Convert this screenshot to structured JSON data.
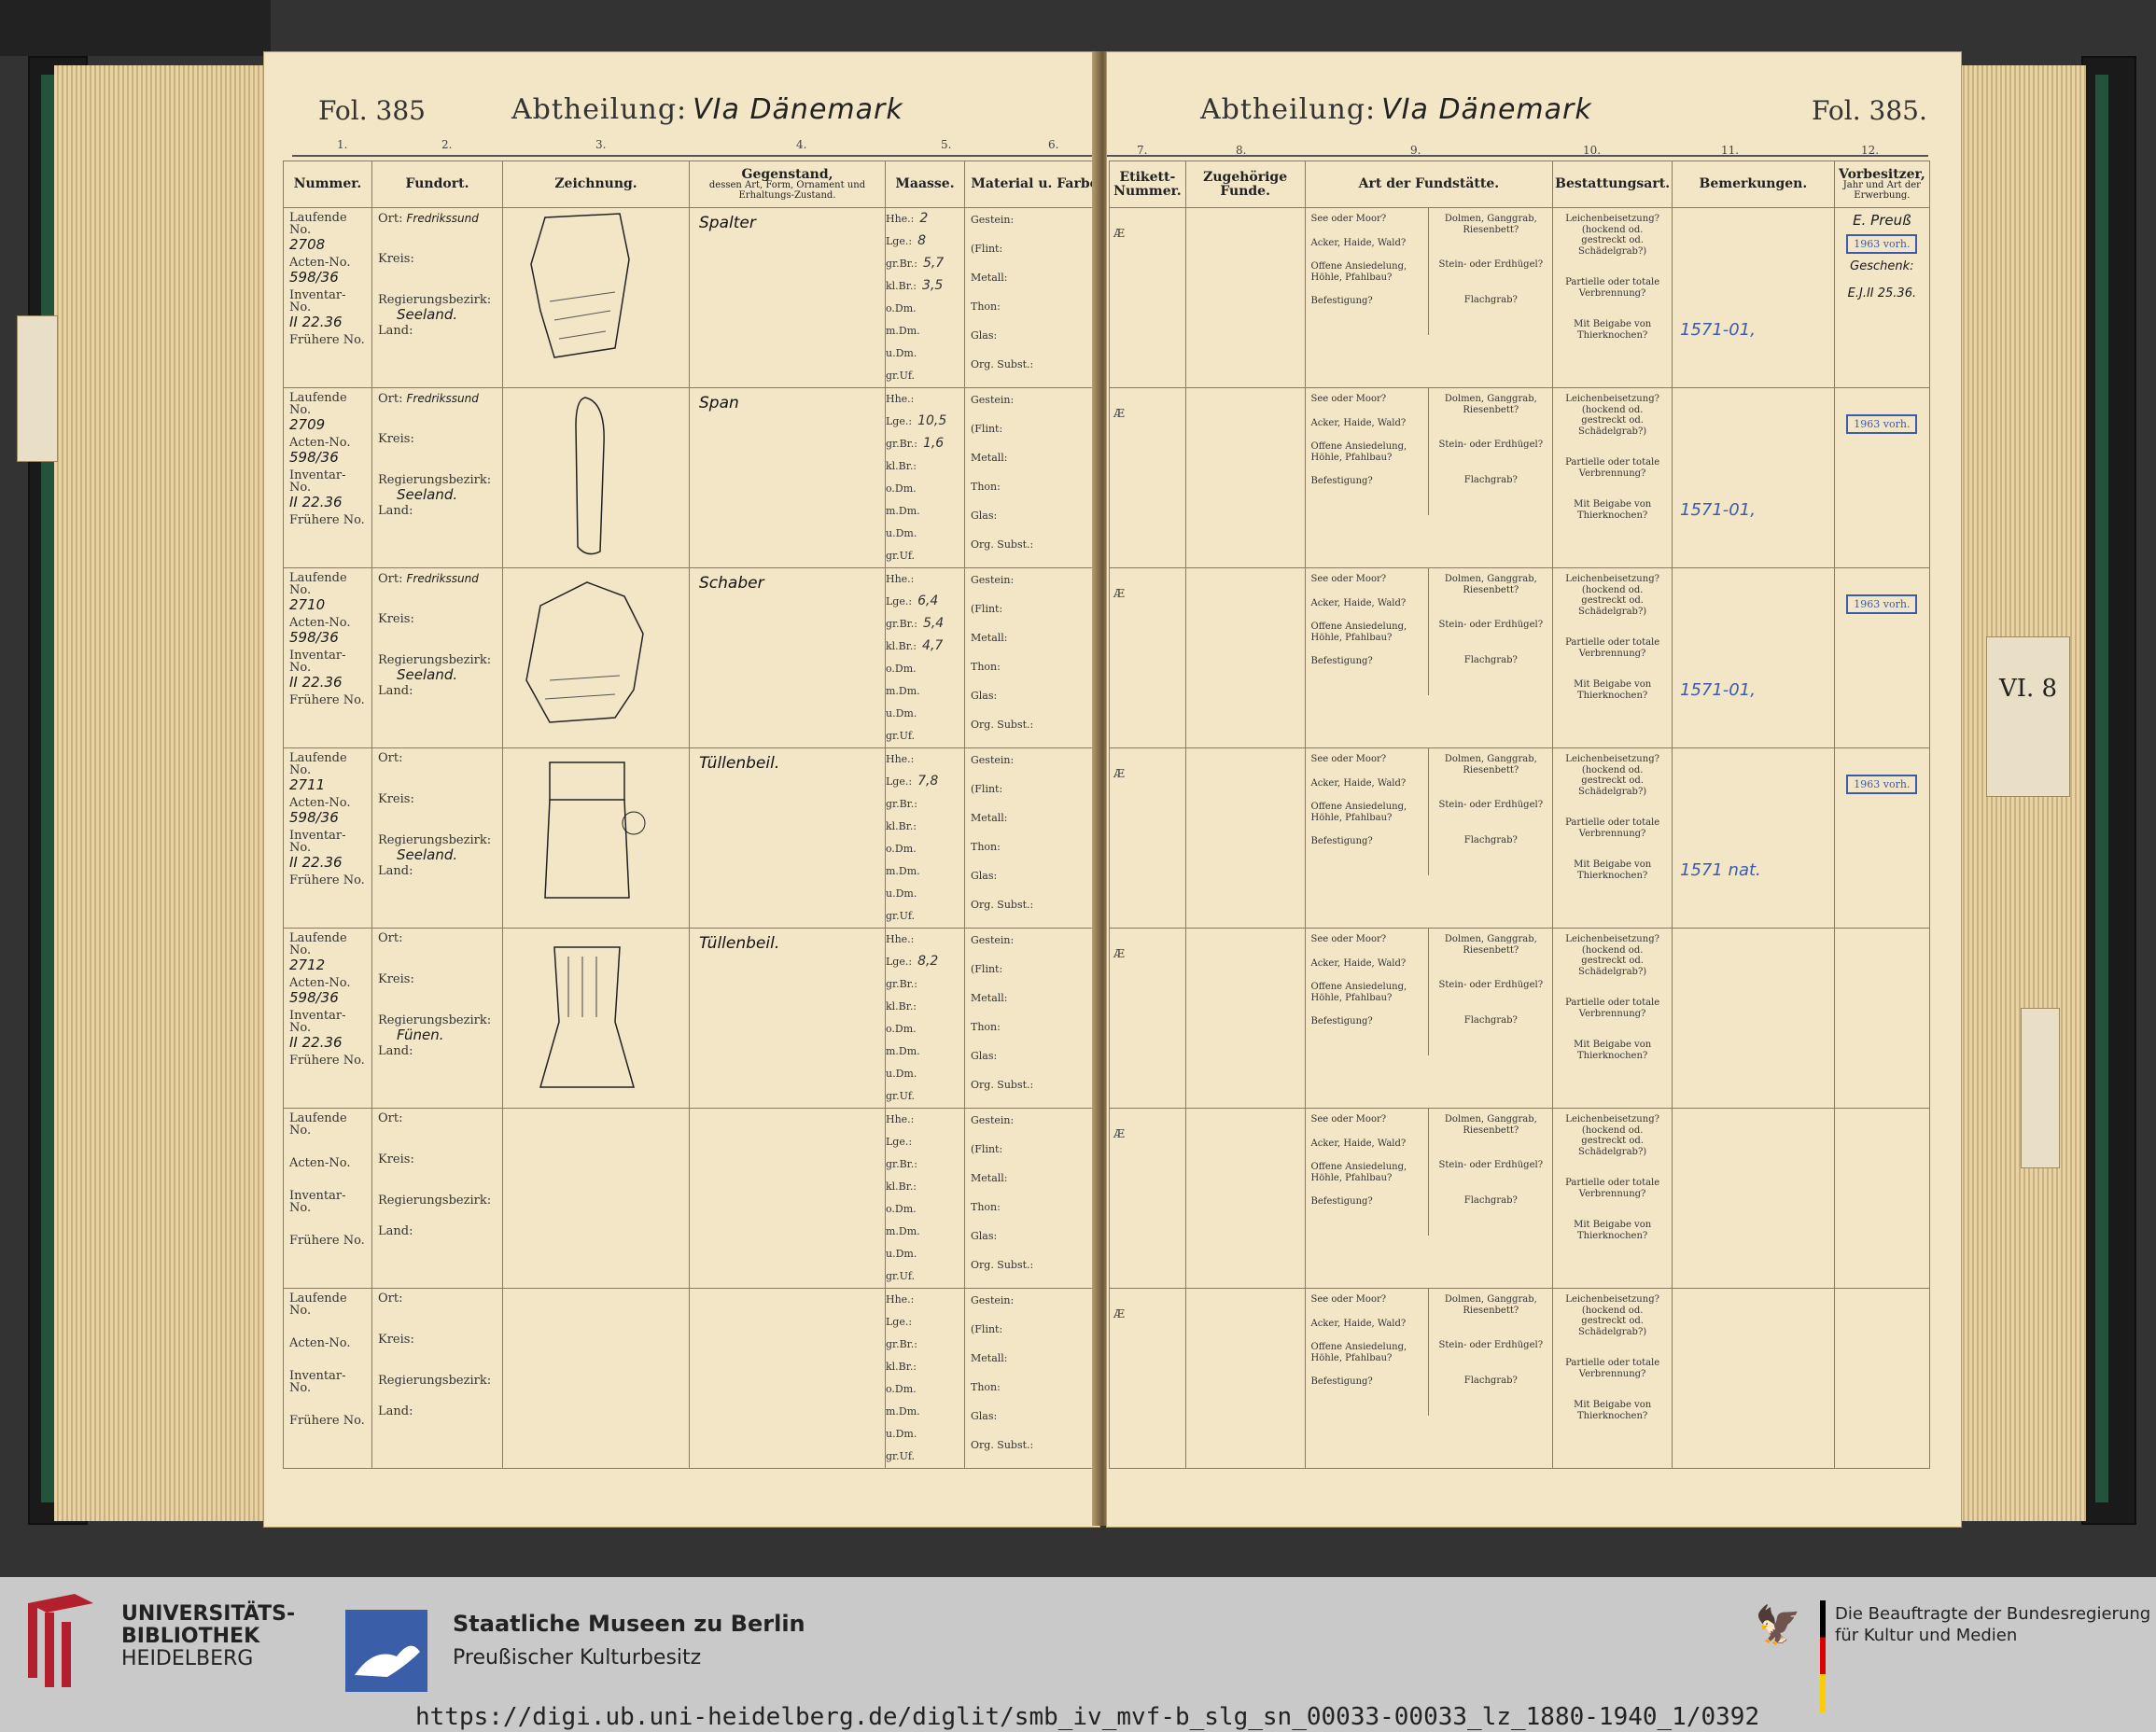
{
  "left_page": {
    "folio_label": "Fol. 385",
    "abtheilung_label": "Abtheilung:",
    "abtheilung_value": "VIa Dänemark",
    "column_numbers": [
      "1.",
      "2.",
      "3.",
      "4.",
      "5.",
      "6."
    ],
    "headers": {
      "nummer": "Nummer.",
      "fundort": "Fundort.",
      "zeichnung": "Zeichnung.",
      "gegenstand": "Gegenstand,",
      "gegenstand_sub": "dessen Art, Form, Ornament und Erhaltungs-Zustand.",
      "maasse": "Maasse.",
      "material": "Material u. Farbe"
    },
    "row_labels": {
      "laufende": "Laufende No.",
      "acten": "Acten-No.",
      "inventar": "Inventar-No.",
      "fruehere": "Frühere No.",
      "ort": "Ort:",
      "kreis": "Kreis:",
      "regbez": "Regierungsbezirk:",
      "land": "Land:"
    },
    "measure_labels": [
      "Hhe.:",
      "Lge.:",
      "gr.Br.:",
      "kl.Br.:",
      "o.Dm.",
      "m.Dm.",
      "u.Dm.",
      "gr.Uf."
    ],
    "material_labels": [
      "Gestein:",
      "(Flint:",
      "Metall:",
      "Thon:",
      "Glas:",
      "Org. Subst.:"
    ],
    "rows": [
      {
        "laufende": "2708",
        "acten": "598/36",
        "inventar": "II 22.36",
        "ort": "Fredrikssund",
        "regbez": "Seeland.",
        "object": "Spalter",
        "measures": [
          "2",
          "8",
          "5,7",
          "3,5",
          "",
          "",
          "",
          ""
        ]
      },
      {
        "laufende": "2709",
        "acten": "598/36",
        "inventar": "II 22.36",
        "ort": "Fredrikssund",
        "regbez": "Seeland.",
        "object": "Span",
        "measures": [
          "",
          "10,5",
          "1,6",
          "",
          "",
          "",
          "",
          ""
        ]
      },
      {
        "laufende": "2710",
        "acten": "598/36",
        "inventar": "II 22.36",
        "ort": "Fredrikssund",
        "regbez": "Seeland.",
        "object": "Schaber",
        "measures": [
          "",
          "6,4",
          "5,4",
          "4,7",
          "",
          "",
          "",
          ""
        ]
      },
      {
        "laufende": "2711",
        "acten": "598/36",
        "inventar": "II 22.36",
        "ort": "",
        "regbez": "Seeland.",
        "object": "Tüllenbeil.",
        "measures": [
          "",
          "7,8",
          "",
          "",
          "",
          "",
          "",
          ""
        ]
      },
      {
        "laufende": "2712",
        "acten": "598/36",
        "inventar": "II 22.36",
        "ort": "",
        "regbez": "Fünen.",
        "object": "Tüllenbeil.",
        "measures": [
          "",
          "8,2",
          "",
          "",
          "",
          "",
          "",
          ""
        ]
      },
      {
        "laufende": "",
        "acten": "",
        "inventar": "",
        "ort": "",
        "regbez": "",
        "object": "",
        "measures": [
          "",
          "",
          "",
          "",
          "",
          "",
          "",
          ""
        ]
      },
      {
        "laufende": "",
        "acten": "",
        "inventar": "",
        "ort": "",
        "regbez": "",
        "object": "",
        "measures": [
          "",
          "",
          "",
          "",
          "",
          "",
          "",
          ""
        ]
      }
    ]
  },
  "right_page": {
    "folio_label": "Fol. 385.",
    "abtheilung_label": "Abtheilung:",
    "abtheilung_value": "VIa Dänemark",
    "column_numbers": [
      "7.",
      "8.",
      "9.",
      "10.",
      "11.",
      "12."
    ],
    "headers": {
      "etikett": "Etikett-Nummer.",
      "zugehoerige": "Zugehörige Funde.",
      "fundstaette": "Art der Fundstätte.",
      "bestattung": "Bestattungsart.",
      "bemerkungen": "Bemerkungen.",
      "vorbesitzer": "Vorbesitzer,",
      "vorbesitzer_sub": "Jahr und Art der Erwerbung."
    },
    "etikett_mark": "Æ",
    "fundstaette_q": [
      "See oder Moor?",
      "Acker, Haide, Wald?",
      "Offene Ansiedelung, Höhle, Pfahlbau?",
      "Befestigung?"
    ],
    "fundstaette_q2": [
      "Dolmen, Ganggrab, Riesenbett?",
      "Stein- oder Erdhügel?",
      "Flachgrab?"
    ],
    "bestattung_q": [
      "Leichenbeisetzung? (hockend od. gestreckt od. Schädelgrab?)",
      "Partielle oder totale Verbrennung?",
      "Mit Beigabe von Thierknochen?"
    ],
    "rows": [
      {
        "bemerkung": "1571-01,",
        "vorbesitzer": "E. Preuß",
        "stamp": "1963 vorh.",
        "note": "Geschenk:",
        "ref": "E.J.II 25.36."
      },
      {
        "bemerkung": "1571-01,",
        "vorbesitzer": "",
        "stamp": "1963 vorh.",
        "note": "",
        "ref": ""
      },
      {
        "bemerkung": "1571-01,",
        "vorbesitzer": "",
        "stamp": "1963 vorh.",
        "note": "",
        "ref": ""
      },
      {
        "bemerkung": "1571 nat.",
        "vorbesitzer": "",
        "stamp": "1963 vorh.",
        "note": "",
        "ref": ""
      },
      {
        "bemerkung": "",
        "vorbesitzer": "",
        "stamp": "",
        "note": "",
        "ref": ""
      },
      {
        "bemerkung": "",
        "vorbesitzer": "",
        "stamp": "",
        "note": "",
        "ref": ""
      },
      {
        "bemerkung": "",
        "vorbesitzer": "",
        "stamp": "",
        "note": "",
        "ref": ""
      }
    ]
  },
  "tab_label": "VI. 8",
  "footer": {
    "ub_lines": [
      "UNIVERSITÄTS-",
      "BIBLIOTHEK",
      "HEIDELBERG"
    ],
    "smb_title": "Staatliche Museen zu Berlin",
    "smb_sub": "Preußischer Kulturbesitz",
    "bkm_lines": [
      "Die Beauftragte der Bundesregierung",
      "für Kultur und Medien"
    ],
    "url": "https://digi.ub.uni-heidelberg.de/diglit/smb_iv_mvf-b_slg_sn_00033-00033_lz_1880-1940_1/0392"
  },
  "colors": {
    "paper": "#f3e6c6",
    "ink_blue": "#3b5bb0",
    "ink_red": "#d3463a",
    "book_green": "#23533c"
  }
}
